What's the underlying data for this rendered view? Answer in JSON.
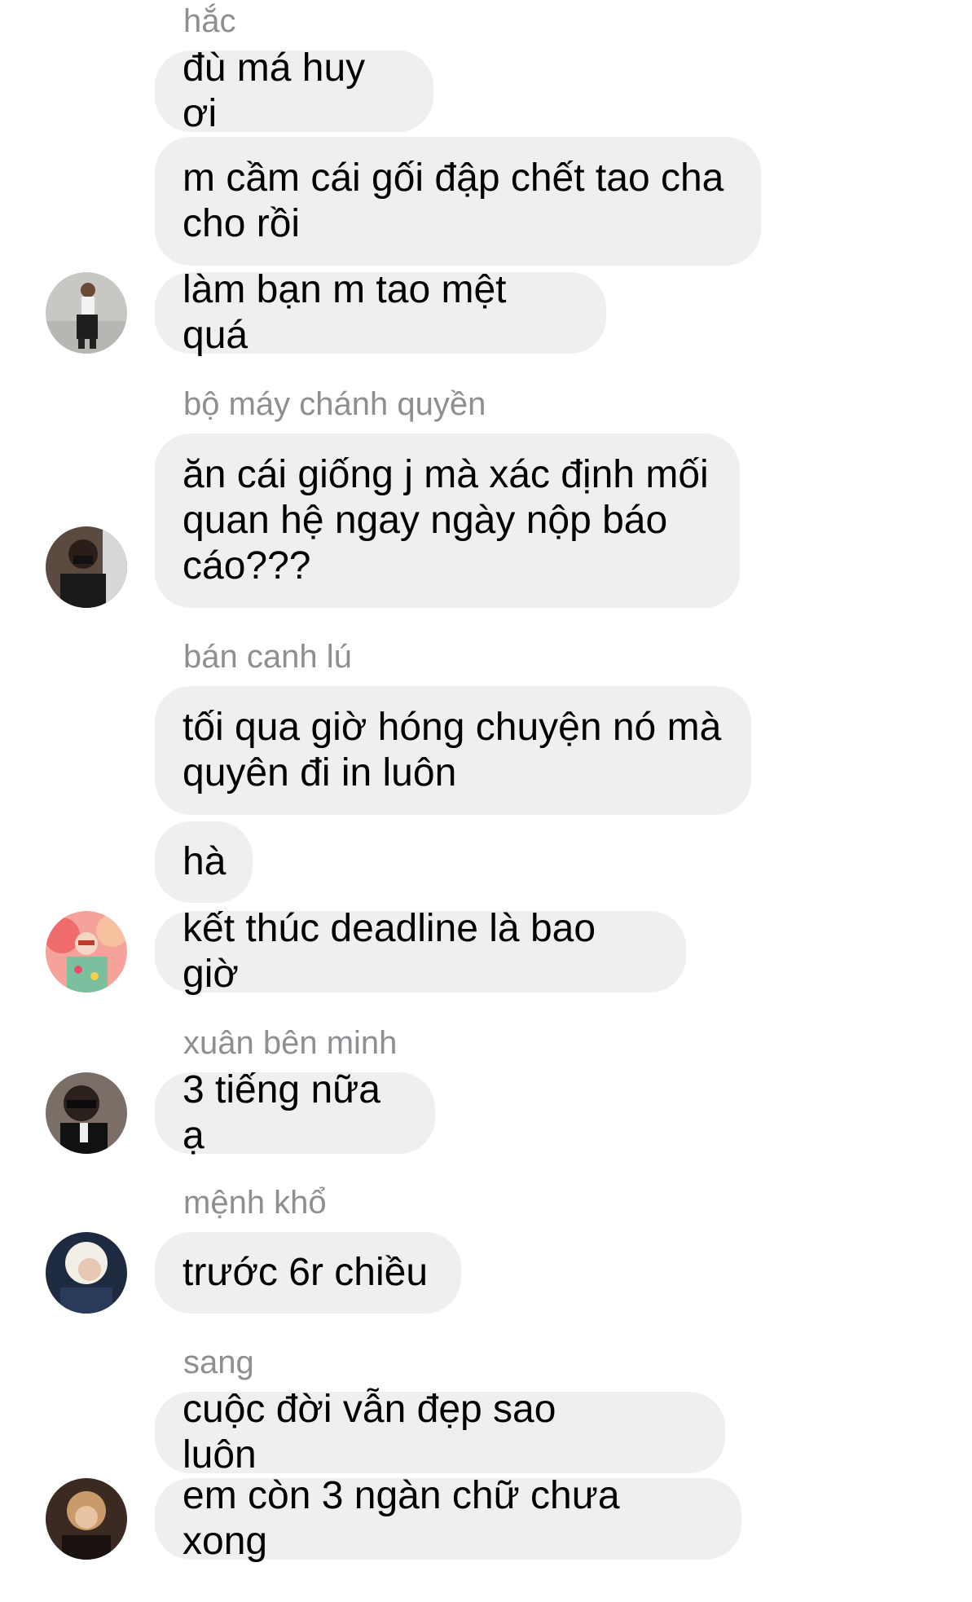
{
  "groups": [
    {
      "sender": "hắc",
      "messages": [
        "đù má huy ơi",
        "m cầm cái gối đập chết tao cha cho rồi",
        "làm bạn m tao mệt quá"
      ],
      "avatar": "user-avatar-icon"
    },
    {
      "sender": "bộ máy chánh quyền",
      "messages": [
        "ăn cái giống j mà xác định mối quan hệ ngay ngày nộp báo cáo???"
      ],
      "avatar": "user-avatar-icon"
    },
    {
      "sender": "bán canh lú",
      "messages": [
        "tối qua giờ hóng chuyện nó mà quyên đi in luôn",
        "hà",
        "kết thúc deadline là bao giờ"
      ],
      "avatar": "user-avatar-icon"
    },
    {
      "sender": "xuân bên minh",
      "messages": [
        "3 tiếng nữa ạ"
      ],
      "avatar": "user-avatar-icon"
    },
    {
      "sender": "mệnh khổ",
      "messages": [
        "trước 6r chiều"
      ],
      "avatar": "user-avatar-icon"
    },
    {
      "sender": "sang",
      "messages": [
        "cuộc đời vẫn đẹp sao luôn",
        "em còn 3 ngàn chữ chưa xong"
      ],
      "avatar": "user-avatar-icon"
    }
  ],
  "emoji": "smiley-emoji-icon",
  "colors": {
    "bubble": "#efeff1",
    "sender": "#8e8e93",
    "text": "#000000"
  }
}
